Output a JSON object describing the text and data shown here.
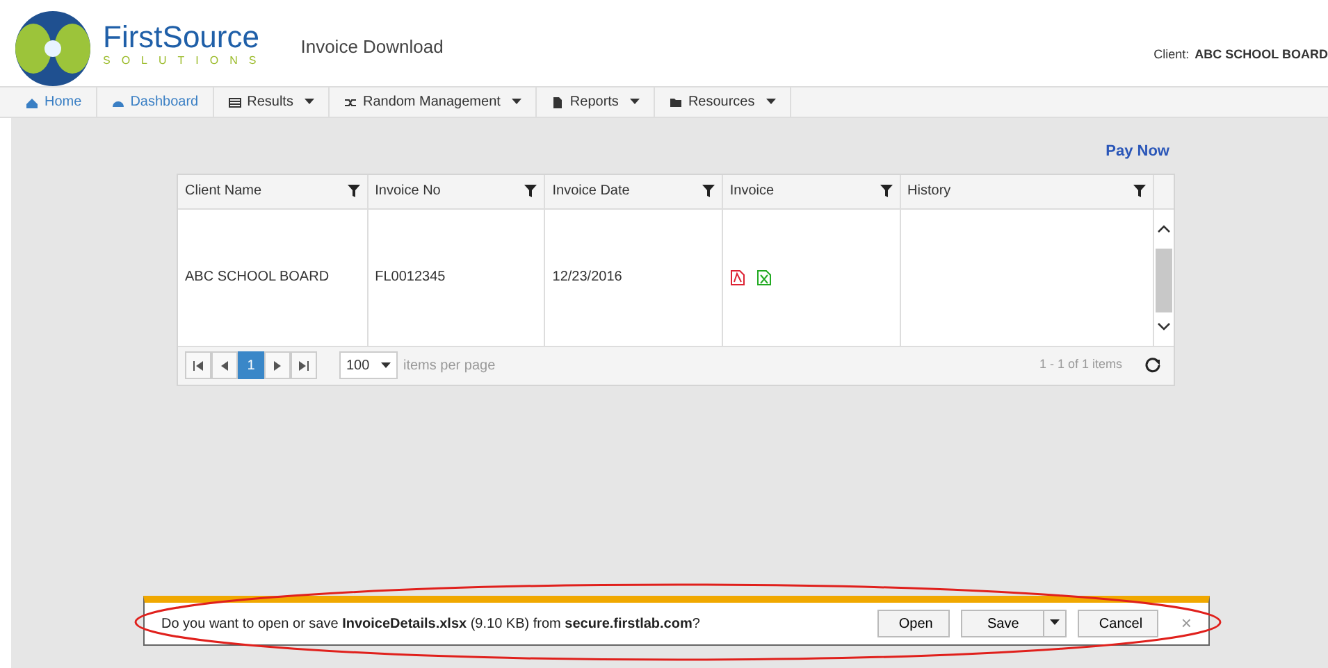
{
  "header": {
    "brand": "FirstSource",
    "brand_sub": "SOLUTIONS",
    "page_title": "Invoice Download",
    "client_label": "Client:",
    "client_name": "ABC SCHOOL BOARD"
  },
  "nav": [
    {
      "label": "Home",
      "kind": "link"
    },
    {
      "label": "Dashboard",
      "kind": "link"
    },
    {
      "label": "Results",
      "kind": "dropdown"
    },
    {
      "label": "Random Management",
      "kind": "dropdown"
    },
    {
      "label": "Reports",
      "kind": "dropdown"
    },
    {
      "label": "Resources",
      "kind": "dropdown"
    }
  ],
  "pay_now": "Pay Now",
  "table": {
    "columns": [
      "Client Name",
      "Invoice No",
      "Invoice Date",
      "Invoice",
      "History"
    ],
    "rows": [
      {
        "client_name": "ABC SCHOOL BOARD",
        "invoice_no": "FL0012345",
        "invoice_date": "12/23/2016"
      }
    ],
    "pager": {
      "pages": [
        {
          "label": "1",
          "selected": true
        }
      ],
      "page_size": "100",
      "page_size_label": "items per page",
      "summary": "1 - 1 of 1 items"
    }
  },
  "download_bar": {
    "message": "Do you want to open or save **InvoiceDetails.xlsx** (9.10 KB) from **secure.firstlab.com**?",
    "buttons": [
      "Open",
      "Save",
      "Cancel"
    ],
    "close": "×"
  }
}
